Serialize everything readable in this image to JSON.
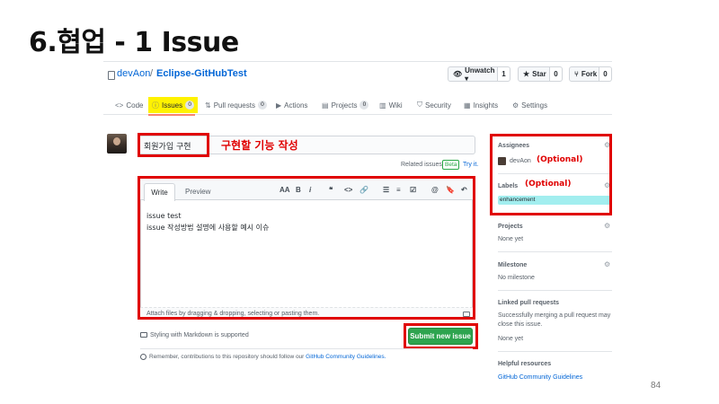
{
  "slide": {
    "title": "6.협업 - 1 Issue",
    "page_number": "84"
  },
  "repo": {
    "owner": "devAon",
    "separator": "/",
    "name": "Eclipse-GitHubTest",
    "buttons": {
      "watch_label": "Unwatch ▾",
      "watch_count": "1",
      "star_label": "Star",
      "star_count": "0",
      "fork_label": "Fork",
      "fork_count": "0"
    }
  },
  "tabs": [
    {
      "label": "Code",
      "icon": "code-icon"
    },
    {
      "label": "Issues",
      "count": "0",
      "icon": "issue-icon",
      "selected": true
    },
    {
      "label": "Pull requests",
      "count": "0",
      "icon": "pull-request-icon"
    },
    {
      "label": "Actions",
      "icon": "play-icon"
    },
    {
      "label": "Projects",
      "count": "0",
      "icon": "project-icon"
    },
    {
      "label": "Wiki",
      "icon": "book-icon"
    },
    {
      "label": "Security",
      "icon": "shield-icon"
    },
    {
      "label": "Insights",
      "icon": "graph-icon"
    },
    {
      "label": "Settings",
      "icon": "gear-icon"
    }
  ],
  "issue_form": {
    "title_value": "회원가입 구현",
    "title_annotation": "구현할 기능 작성",
    "related_issues": "Related issues",
    "beta": "Beta",
    "try_it": "Try it.",
    "editor": {
      "tab_write": "Write",
      "tab_preview": "Preview",
      "toolbar": [
        "AA",
        "B",
        "i",
        "❝",
        "<>",
        "🔗",
        "☰",
        "≡",
        "☑",
        "@",
        "🔖",
        "↶"
      ],
      "body_lines": [
        "issue test",
        "issue 작성방법 설명에 사용할 예시 이슈"
      ],
      "attach_text": "Attach files by dragging & dropping, selecting or pasting them."
    },
    "styling_note": "Styling with Markdown is supported",
    "submit_label": "Submit new issue",
    "remember_text": "Remember, contributions to this repository should follow our",
    "guidelines_link": "GitHub Community Guidelines."
  },
  "sidebar": {
    "assignees": {
      "heading": "Assignees",
      "user": "devAon",
      "annotation": "(Optional)"
    },
    "labels": {
      "heading": "Labels",
      "annotation": "(Optional)",
      "chip": "enhancement",
      "chip_color": "#a2eeef"
    },
    "projects": {
      "heading": "Projects",
      "value": "None yet"
    },
    "milestone": {
      "heading": "Milestone",
      "value": "No milestone"
    },
    "linked_prs": {
      "heading": "Linked pull requests",
      "line1": "Successfully merging a pull request may",
      "line2": "close this issue.",
      "value": "None yet"
    },
    "helpful": {
      "heading": "Helpful resources",
      "link": "GitHub Community Guidelines"
    }
  },
  "colors": {
    "annotation_red": "#e00000",
    "issues_highlight": "#fff200",
    "submit_green": "#2ea44f",
    "link_blue": "#0366d6"
  }
}
